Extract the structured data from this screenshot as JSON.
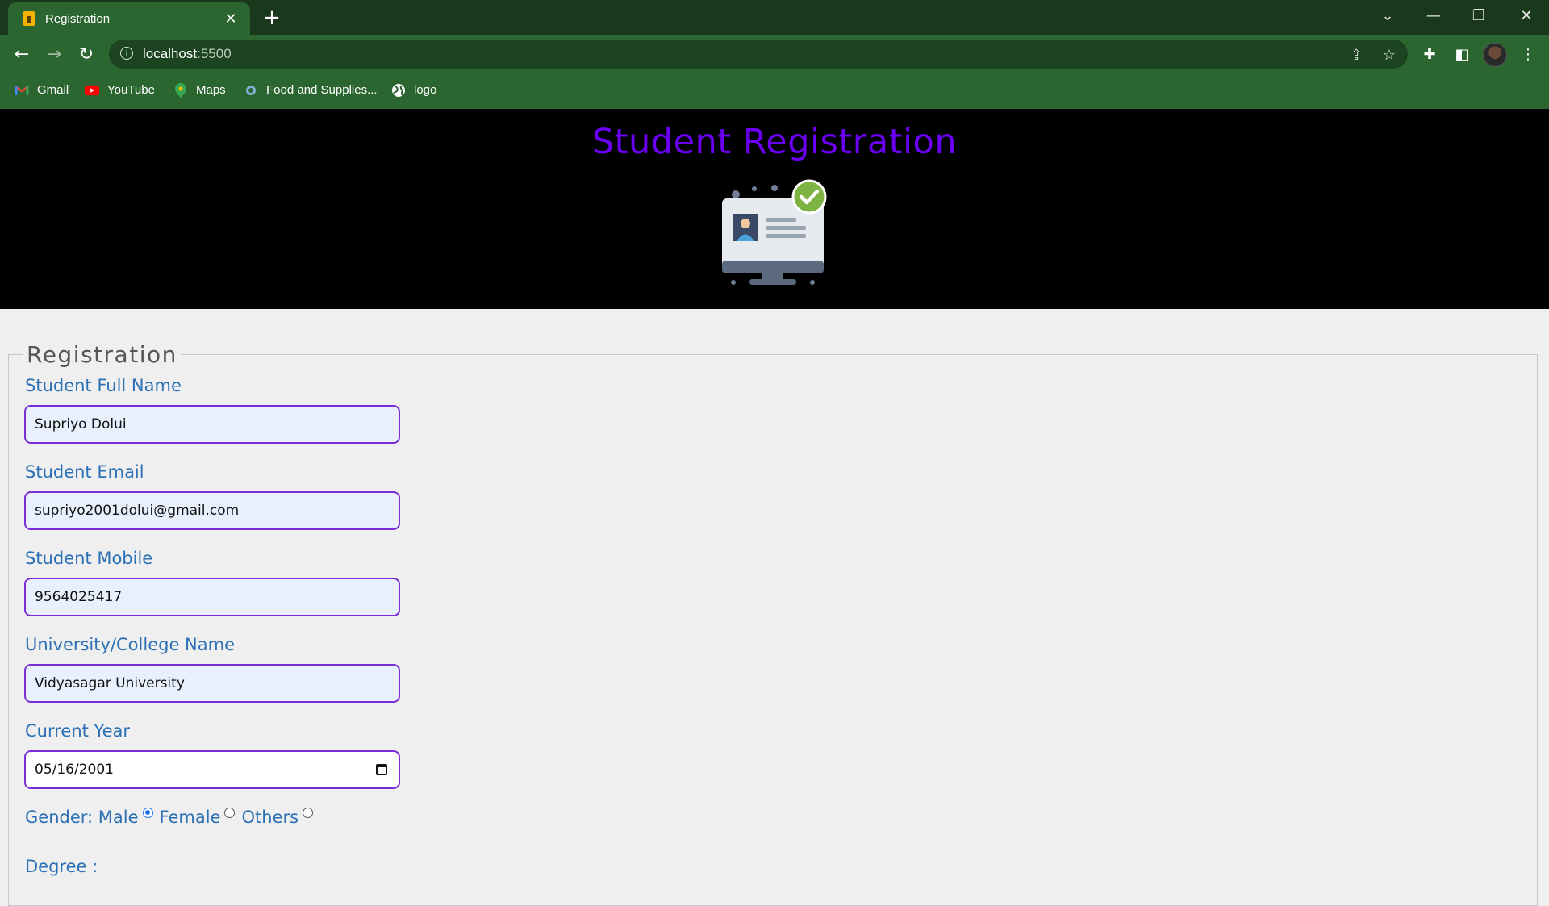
{
  "browser": {
    "tab_title": "Registration",
    "url_host": "localhost",
    "url_port": ":5500",
    "bookmarks": [
      "Gmail",
      "YouTube",
      "Maps",
      "Food and Supplies...",
      "logo"
    ]
  },
  "page": {
    "heading": "Student Registration",
    "form_legend": "Registration",
    "fields": {
      "full_name": {
        "label": "Student Full Name",
        "value": "Supriyo Dolui"
      },
      "email": {
        "label": "Student Email",
        "value": "supriyo2001dolui@gmail.com"
      },
      "mobile": {
        "label": "Student Mobile",
        "value": "9564025417"
      },
      "college": {
        "label": "University/College Name",
        "value": "Vidyasagar University"
      },
      "year": {
        "label": "Current Year",
        "value": "05/16/2001"
      }
    },
    "gender": {
      "label": "Gender:",
      "options": [
        "Male",
        "Female",
        "Others"
      ],
      "selected": "Male"
    },
    "degree_label": "Degree :"
  },
  "colors": {
    "heading": "#6a00f4",
    "labels": "#2b70b5",
    "input_border": "#7a2dd6",
    "browser_frame": "#2b6530"
  }
}
